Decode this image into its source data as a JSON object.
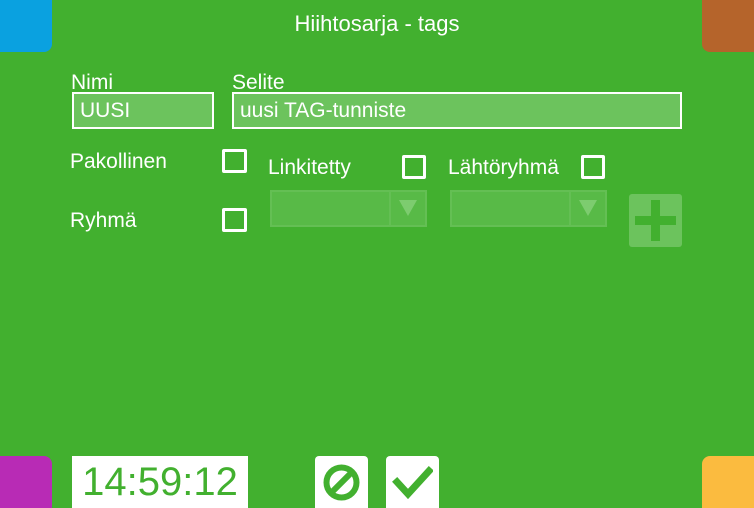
{
  "title": "Hiihtosarja - tags",
  "form": {
    "name_label": "Nimi",
    "name_value": "UUSI",
    "desc_label": "Selite",
    "desc_value": "uusi TAG-tunniste",
    "mandatory_label": "Pakollinen",
    "linked_label": "Linkitetty",
    "start_group_label": "Lähtöryhmä",
    "group_label": "Ryhmä"
  },
  "footer": {
    "clock": "14:59:12"
  },
  "colors": {
    "background": "#42b02f",
    "corner_top_left": "#0aa1e0",
    "corner_top_right": "#b5642b",
    "corner_bottom_left": "#b82bb5",
    "corner_bottom_right": "#fbbb3f"
  },
  "icons": {
    "cancel": "cancel-icon",
    "confirm": "checkmark-icon",
    "add": "plus-icon",
    "dropdown": "triangle-down-icon"
  }
}
